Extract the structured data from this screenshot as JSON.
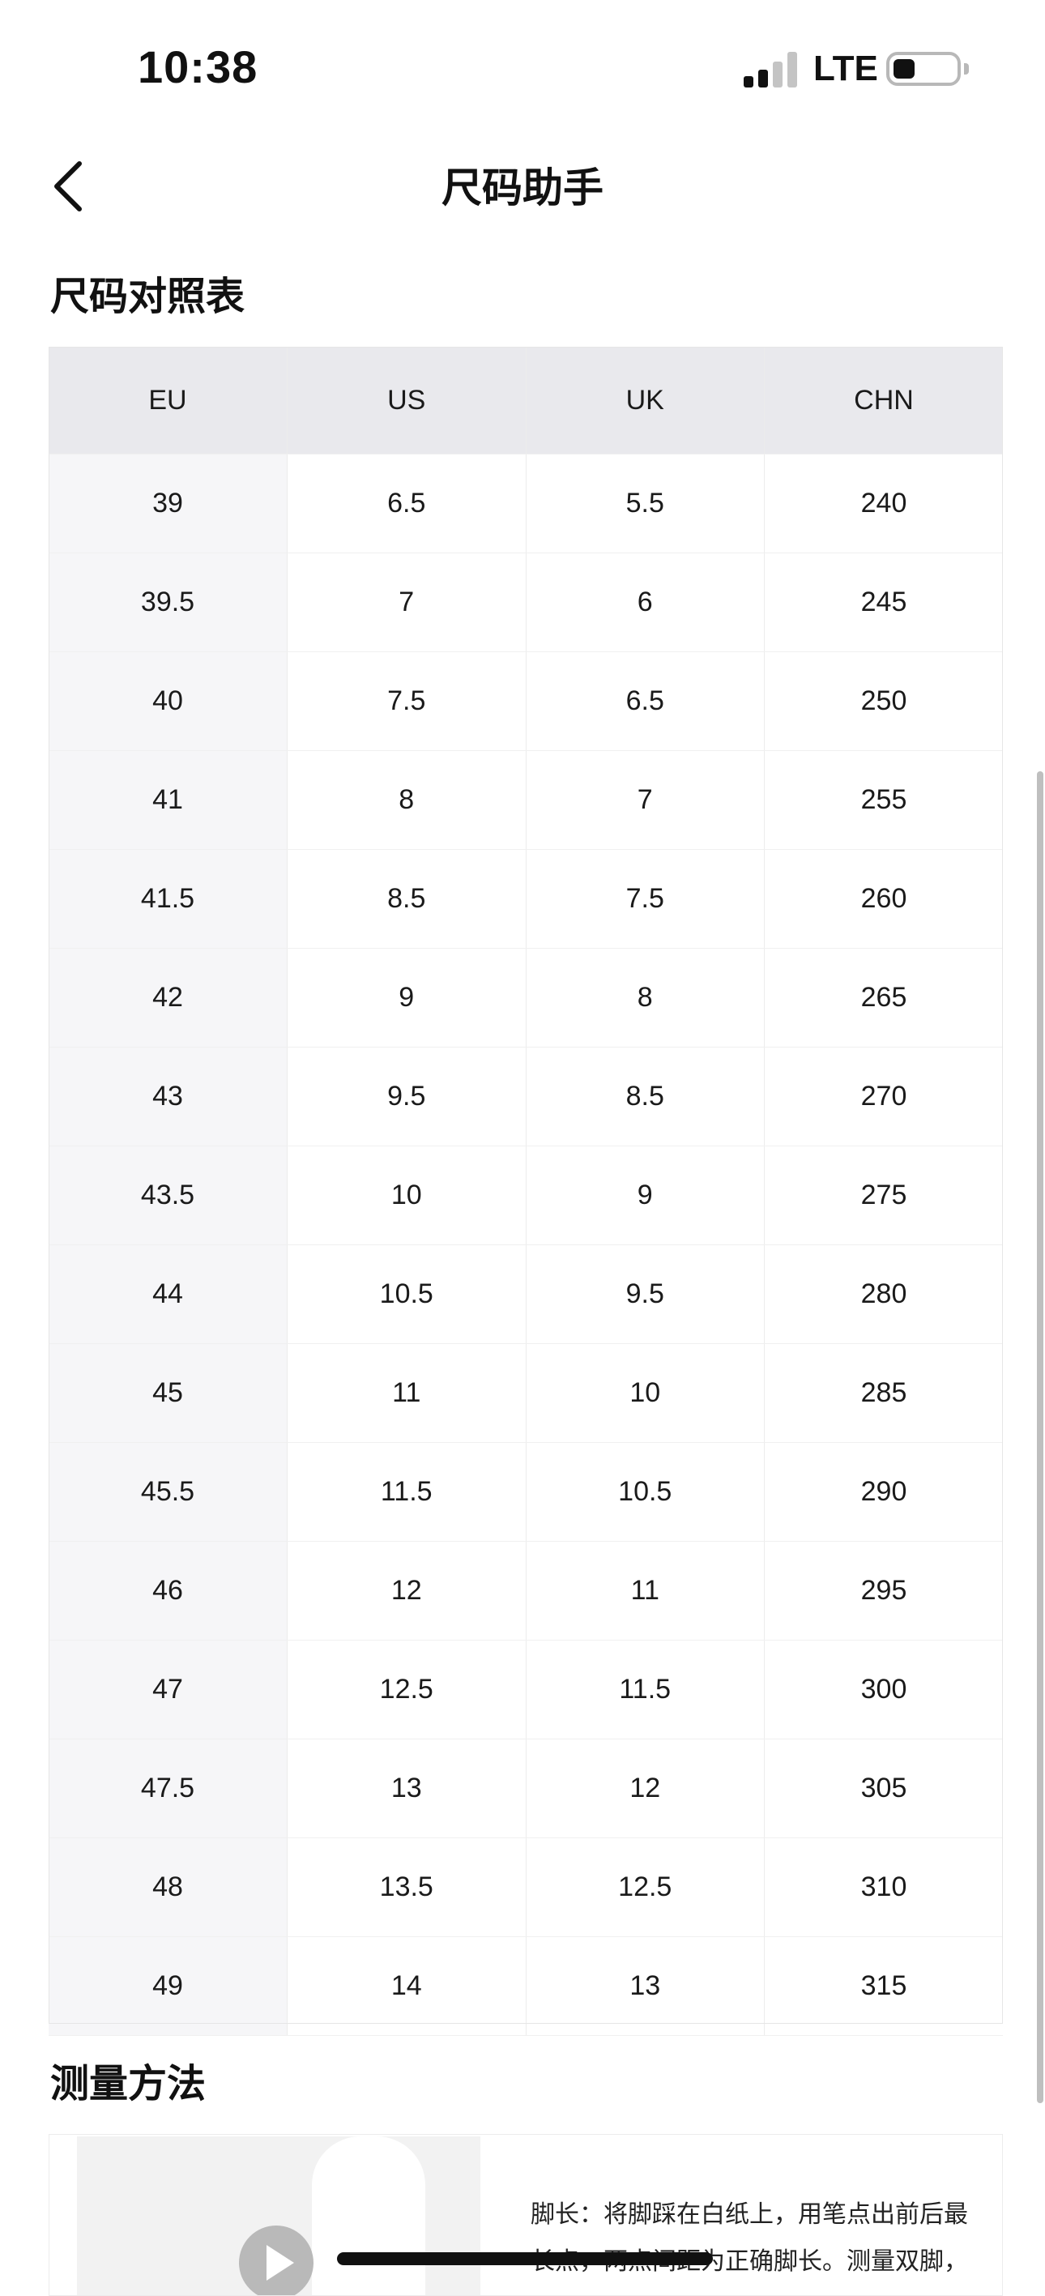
{
  "status_bar": {
    "time": "10:38",
    "network": "LTE",
    "signal_bars_active": 2,
    "signal_bars_total": 4
  },
  "nav": {
    "title": "尺码助手",
    "back_icon": "chevron-left-icon"
  },
  "size_chart": {
    "section_title": "尺码对照表",
    "columns": [
      "EU",
      "US",
      "UK",
      "CHN"
    ],
    "rows": [
      [
        "39",
        "6.5",
        "5.5",
        "240"
      ],
      [
        "39.5",
        "7",
        "6",
        "245"
      ],
      [
        "40",
        "7.5",
        "6.5",
        "250"
      ],
      [
        "41",
        "8",
        "7",
        "255"
      ],
      [
        "41.5",
        "8.5",
        "7.5",
        "260"
      ],
      [
        "42",
        "9",
        "8",
        "265"
      ],
      [
        "43",
        "9.5",
        "8.5",
        "270"
      ],
      [
        "43.5",
        "10",
        "9",
        "275"
      ],
      [
        "44",
        "10.5",
        "9.5",
        "280"
      ],
      [
        "45",
        "11",
        "10",
        "285"
      ],
      [
        "45.5",
        "11.5",
        "10.5",
        "290"
      ],
      [
        "46",
        "12",
        "11",
        "295"
      ],
      [
        "47",
        "12.5",
        "11.5",
        "300"
      ],
      [
        "47.5",
        "13",
        "12",
        "305"
      ],
      [
        "48",
        "13.5",
        "12.5",
        "310"
      ],
      [
        "49",
        "14",
        "13",
        "315"
      ]
    ]
  },
  "measure": {
    "section_title": "测量方法",
    "text": "脚长：将脚踩在白纸上，用笔点出前后最长点，两点间距为正确脚长。测量双脚，",
    "play_icon": "play-icon"
  },
  "colors": {
    "header_bg": "#e9e9ed",
    "first_col_bg": "#f6f6f8",
    "text": "#111111"
  }
}
